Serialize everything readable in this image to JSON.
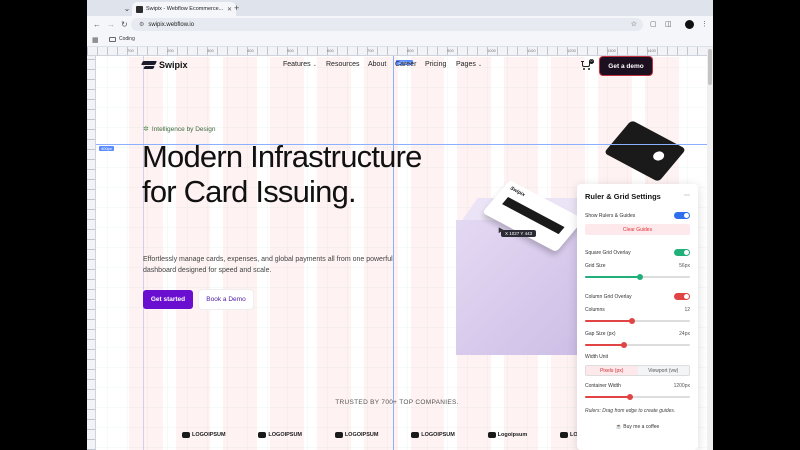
{
  "browser": {
    "tab_title": "Swipix - Webflow Ecommerce...",
    "url": "swipix.webflow.io",
    "bookmark_folder": "Coding"
  },
  "rulers": {
    "ticks": [
      "700",
      "200",
      "300",
      "400",
      "500",
      "600",
      "700",
      "800",
      "900",
      "1000",
      "1100",
      "1200",
      "1300",
      "1400"
    ],
    "guide_v_badge": "1004px",
    "guide_h_badge": "400px"
  },
  "site": {
    "logo": "Swipix",
    "nav": [
      {
        "label": "Features",
        "caret": true
      },
      {
        "label": "Resources",
        "caret": false
      },
      {
        "label": "About",
        "caret": false
      },
      {
        "label": "Career",
        "caret": false
      },
      {
        "label": "Pricing",
        "caret": false
      },
      {
        "label": "Pages",
        "caret": true
      }
    ],
    "cart_count": "0",
    "cta": "Get a demo"
  },
  "hero": {
    "eyebrow": "Intelligence by Design",
    "title": "Modern Infrastructure for Card Issuing.",
    "subtitle": "Effortlessly manage cards, expenses, and global payments all from one powerful dashboard designed for speed and scale.",
    "primary_button": "Get started",
    "secondary_button": "Book a Demo",
    "card_name": "Swipix",
    "cursor_readout": "X 1027  Y 443"
  },
  "trusted": {
    "text": "TRUSTED BY 700+ TOP COMPANIES.",
    "logos": [
      "LOGOIPSUM",
      "LOGOIPSUM",
      "LOGOIPSUM",
      "LOGOIPSUM",
      "Logoipsum",
      "LOG"
    ]
  },
  "panel": {
    "title": "Ruler & Grid Settings",
    "show_rulers_label": "Show Rulers & Guides",
    "show_rulers_on": true,
    "clear_guides": "Clear Guides",
    "square_grid_label": "Square Grid Overlay",
    "square_grid_on": true,
    "grid_size_label": "Grid Size",
    "grid_size_value": "56px",
    "grid_size_fraction": 0.52,
    "column_grid_label": "Column Grid Overlay",
    "column_grid_on": true,
    "columns_label": "Columns",
    "columns_value": "12",
    "columns_fraction": 0.45,
    "gap_label": "Gap Size (px)",
    "gap_value": "24px",
    "gap_fraction": 0.37,
    "width_unit_label": "Width Unit",
    "unit_px": "Pixels (px)",
    "unit_vw": "Viewport (vw)",
    "container_width_label": "Container Width",
    "container_width_value": "1200px",
    "container_width_fraction": 0.43,
    "hint": "Rulers: Drag from edge to create guides.",
    "coffee": "☕ Buy me a coffee"
  },
  "colors": {
    "toggle_blue": "#2f6fed",
    "toggle_green": "#22b07a",
    "toggle_red": "#e04444",
    "primary_purple": "#6a0fcf"
  }
}
